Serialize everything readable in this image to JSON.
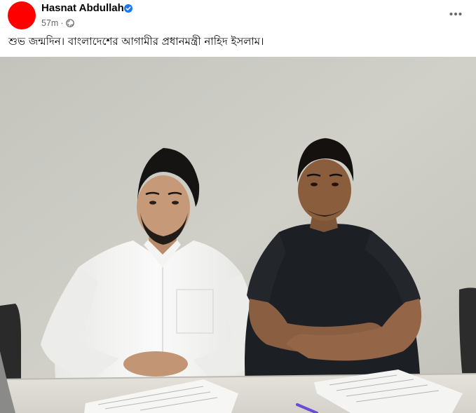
{
  "post": {
    "author": "Hasnat Abdullah",
    "time": "57m",
    "separator": "·",
    "caption": "শুভ জন্মদিন। বাংলাদেশের আগামীর প্রধানমন্ত্রী নাহিদ ইসলাম।",
    "avatar_color": "#ff0000",
    "verified_badge_color": "#1877f2",
    "privacy_icon": "globe-icon",
    "more_icon": "more-options-icon"
  }
}
